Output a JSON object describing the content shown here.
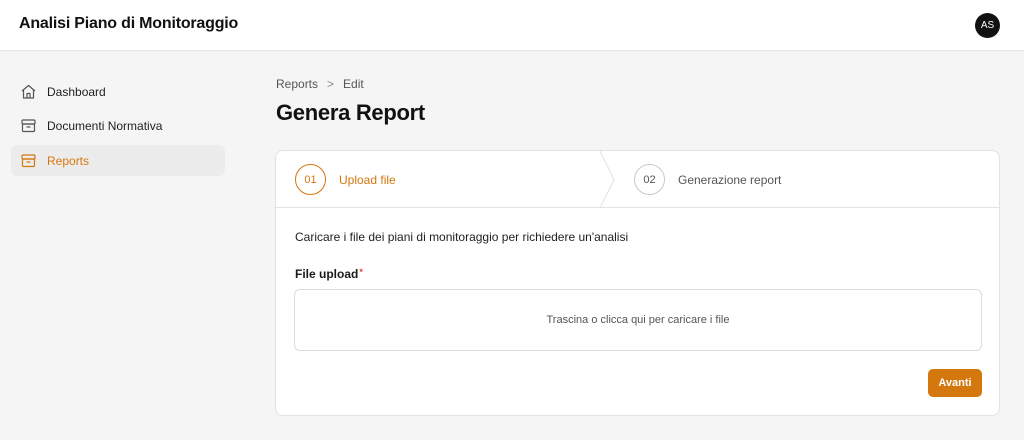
{
  "app": {
    "title": "Analisi Piano di Monitoraggio",
    "user_initials": "AS"
  },
  "sidebar": {
    "items": [
      {
        "label": "Dashboard",
        "icon": "home-icon",
        "active": false
      },
      {
        "label": "Documenti Normativa",
        "icon": "archive-icon",
        "active": false
      },
      {
        "label": "Reports",
        "icon": "archive-icon",
        "active": true
      }
    ]
  },
  "breadcrumb": {
    "items": [
      "Reports",
      "Edit"
    ],
    "separator": ">"
  },
  "page": {
    "title": "Genera Report"
  },
  "stepper": {
    "steps": [
      {
        "number": "01",
        "label": "Upload file",
        "active": true
      },
      {
        "number": "02",
        "label": "Generazione report",
        "active": false
      }
    ]
  },
  "form": {
    "description": "Caricare i file dei piani di monitoraggio per richiedere un'analisi",
    "upload_label": "File upload",
    "required_mark": "*",
    "dropzone_text": "Trascina o clicca qui per caricare i file",
    "next_button": "Avanti"
  },
  "colors": {
    "accent": "#d4770f",
    "sidebar_active_bg": "#ececec",
    "background": "#f5f5f5"
  }
}
